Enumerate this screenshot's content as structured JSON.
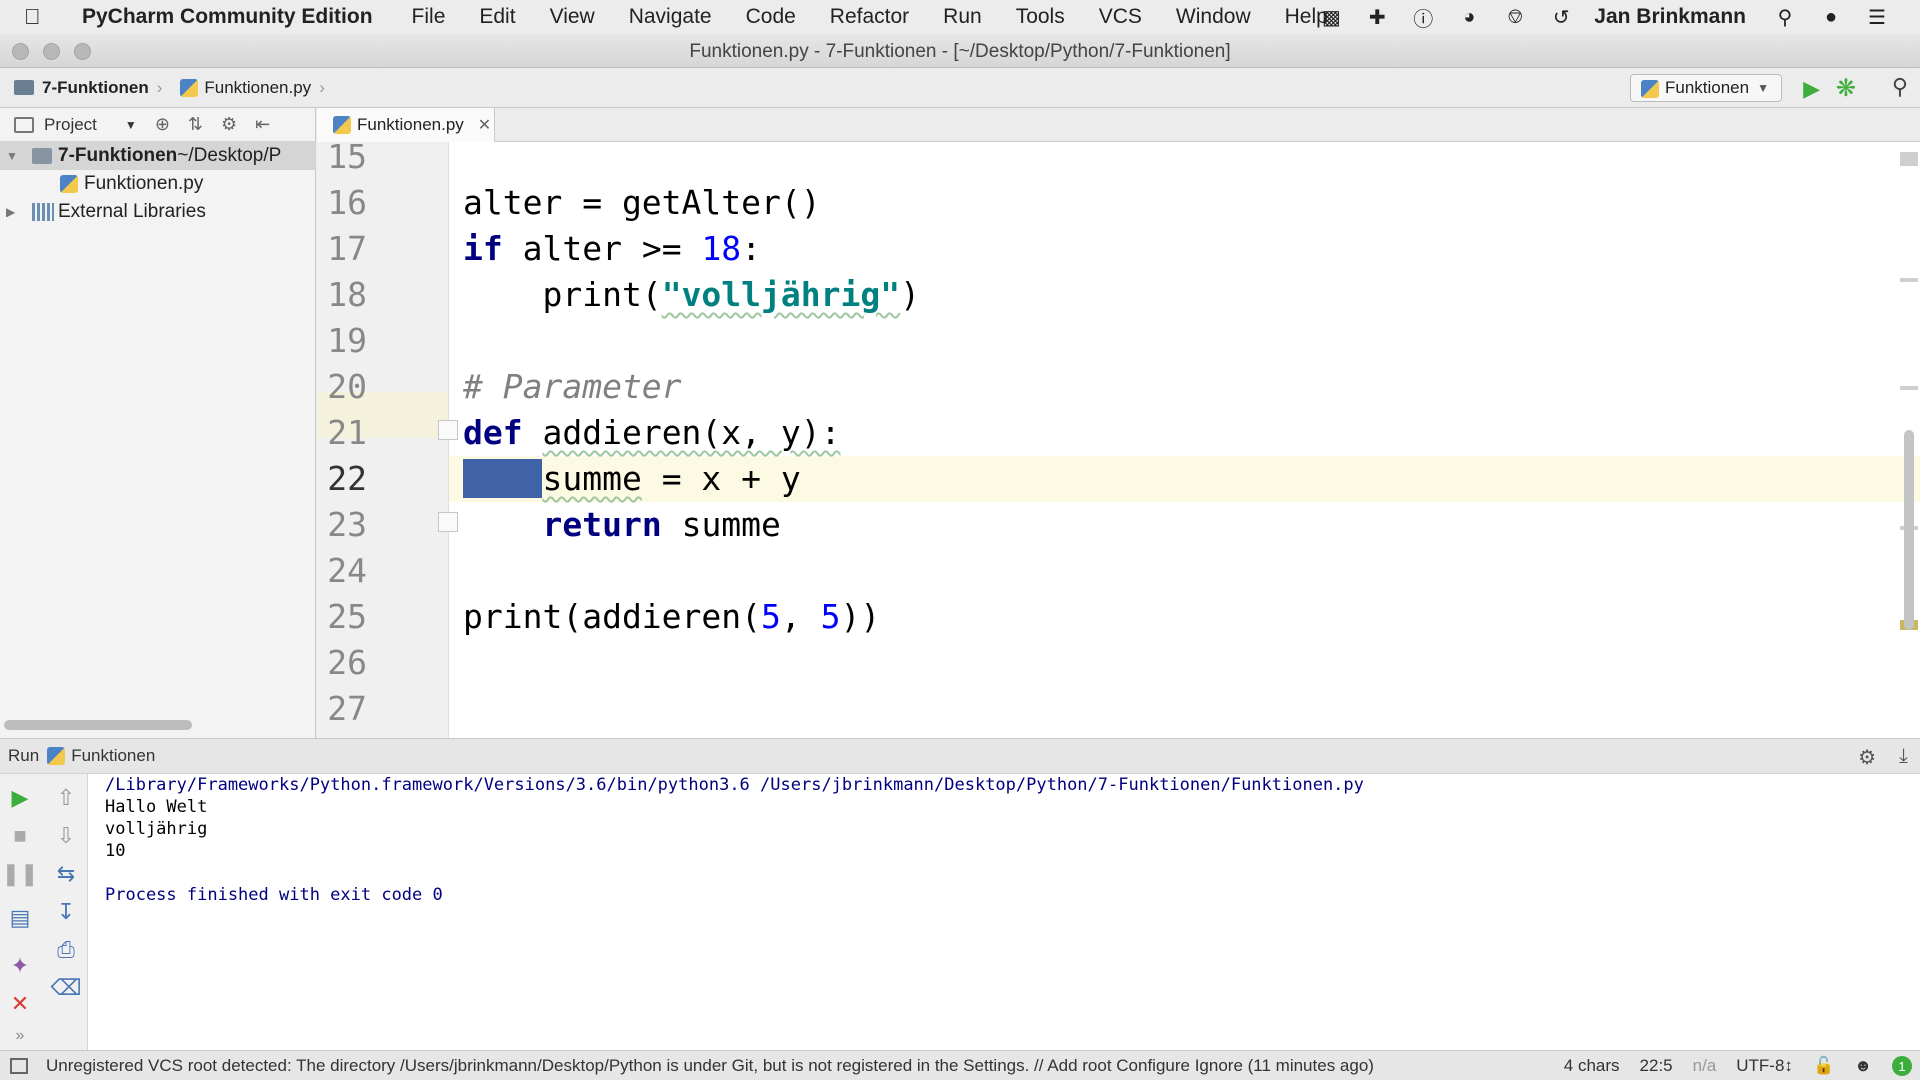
{
  "menubar": {
    "app_name": "PyCharm Community Edition",
    "items": [
      "File",
      "Edit",
      "View",
      "Navigate",
      "Code",
      "Refactor",
      "Run",
      "Tools",
      "VCS",
      "Window",
      "Help"
    ],
    "user": "Jan Brinkmann"
  },
  "window": {
    "title": "Funktionen.py - 7-Funktionen - [~/Desktop/Python/7-Funktionen]"
  },
  "navbar": {
    "crumb_project": "7-Funktionen",
    "crumb_file": "Funktionen.py",
    "run_config": "Funktionen"
  },
  "project": {
    "header": "Project",
    "tree": [
      {
        "label": "7-Funktionen",
        "path": " ~/Desktop/P"
      },
      {
        "label": "Funktionen.py"
      },
      {
        "label": "External Libraries"
      }
    ]
  },
  "editor": {
    "tab": "Funktionen.py",
    "line_numbers": [
      "15",
      "16",
      "17",
      "18",
      "19",
      "20",
      "21",
      "22",
      "23",
      "24",
      "25",
      "26",
      "27"
    ],
    "current_line": "22"
  },
  "run": {
    "label": "Run",
    "config": "Funktionen",
    "console": [
      "/Library/Frameworks/Python.framework/Versions/3.6/bin/python3.6 /Users/jbrinkmann/Desktop/Python/7-Funktionen/Funktionen.py",
      "Hallo Welt",
      "volljährig",
      "10",
      "",
      "Process finished with exit code 0"
    ]
  },
  "statusbar": {
    "message": "Unregistered VCS root detected: The directory /Users/jbrinkmann/Desktop/Python is under Git, but is not registered in the Settings. // Add root  Configure  Ignore (11 minutes ago)",
    "chars": "4 chars",
    "position": "22:5",
    "na": "n/a",
    "encoding": "UTF-8↕",
    "events": "1"
  },
  "colors": {
    "selection": "#3f63a6",
    "run_green": "#3dae3d",
    "keyword": "#000080",
    "number": "#0000ff",
    "string": "#008080",
    "comment": "#808080"
  }
}
